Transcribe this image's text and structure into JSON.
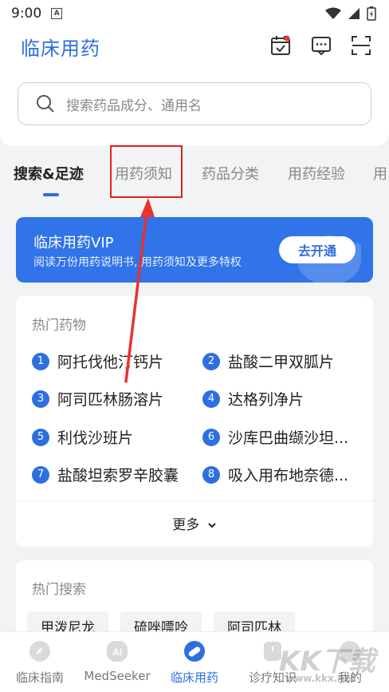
{
  "status": {
    "time": "9:00",
    "indicator": "A"
  },
  "header": {
    "logo": "临床用药",
    "icons": [
      "calendar-check-icon",
      "message-icon",
      "scan-icon"
    ],
    "search_placeholder": "搜索药品成分、通用名"
  },
  "tabs": [
    {
      "label": "搜索&足迹",
      "active": true
    },
    {
      "label": "用药须知",
      "highlighted": true
    },
    {
      "label": "药品分类"
    },
    {
      "label": "用药经验"
    },
    {
      "label": "用"
    }
  ],
  "vip": {
    "title": "临床用药VIP",
    "subtitle": "阅读万份用药说明书, 用药须知及更多特权",
    "button": "去开通"
  },
  "hot_drugs": {
    "title": "热门药物",
    "items": [
      {
        "num": "1",
        "name": "阿托伐他汀钙片"
      },
      {
        "num": "2",
        "name": "盐酸二甲双胍片"
      },
      {
        "num": "3",
        "name": "阿司匹林肠溶片"
      },
      {
        "num": "4",
        "name": "达格列净片"
      },
      {
        "num": "5",
        "name": "利伐沙班片"
      },
      {
        "num": "6",
        "name": "沙库巴曲缬沙坦..."
      },
      {
        "num": "7",
        "name": "盐酸坦索罗辛胶囊"
      },
      {
        "num": "8",
        "name": "吸入用布地奈德..."
      }
    ],
    "more": "更多"
  },
  "hot_search": {
    "title": "热门搜索",
    "tags": [
      "甲泼尼龙",
      "硫唑嘌呤",
      "阿司匹林"
    ]
  },
  "nav": [
    {
      "label": "临床指南"
    },
    {
      "label": "MedSeeker"
    },
    {
      "label": "临床用药",
      "active": true
    },
    {
      "label": "诊疗知识"
    },
    {
      "label": "我的"
    }
  ],
  "watermark": {
    "text": "KK下载",
    "url": "www.kkx.net"
  },
  "colors": {
    "accent": "#2e6fe0",
    "highlight": "#e02020"
  }
}
